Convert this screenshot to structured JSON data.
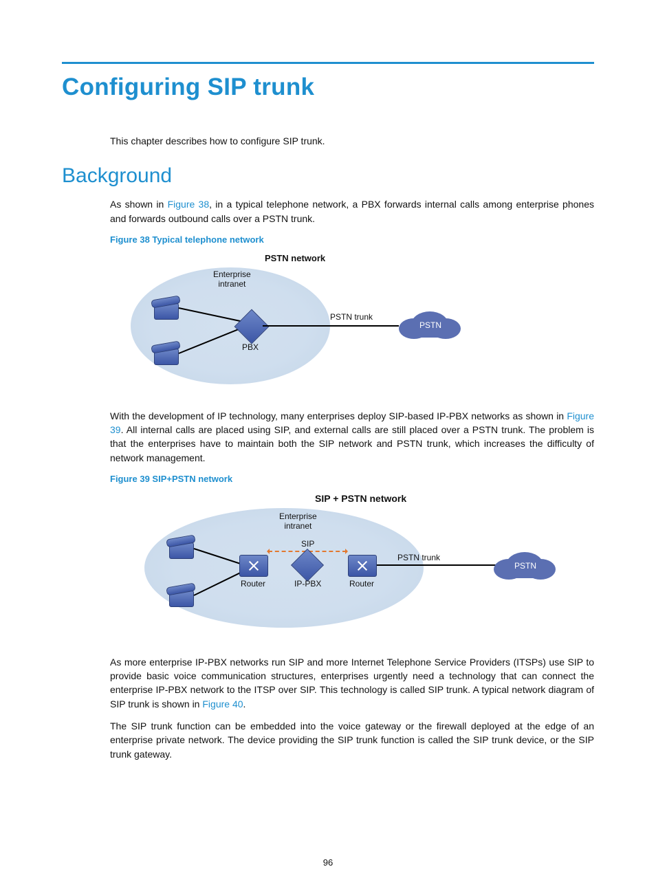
{
  "page_number": "96",
  "title": "Configuring SIP trunk",
  "intro": "This chapter describes how to configure SIP trunk.",
  "section_background": "Background",
  "para1_a": "As shown in ",
  "para1_link": "Figure 38",
  "para1_b": ", in a typical telephone network, a PBX forwards internal calls among enterprise phones and forwards outbound calls over a PSTN trunk.",
  "fig38_caption": "Figure 38 Typical telephone network",
  "fig38": {
    "net_title": "PSTN network",
    "intranet_l1": "Enterprise",
    "intranet_l2": "intranet",
    "pbx": "PBX",
    "trunk": "PSTN trunk",
    "cloud": "PSTN"
  },
  "para2_a": "With the development of IP technology, many enterprises deploy SIP-based IP-PBX networks as shown in ",
  "para2_link": "Figure 39",
  "para2_b": ". All internal calls are placed using SIP, and external calls are still placed over a PSTN trunk. The problem is that the enterprises have to maintain both the SIP network and PSTN trunk, which increases the difficulty of network management.",
  "fig39_caption": "Figure 39 SIP+PSTN network",
  "fig39": {
    "net_title": "SIP + PSTN network",
    "intranet_l1": "Enterprise",
    "intranet_l2": "intranet",
    "sip": "SIP",
    "router": "Router",
    "ippbx": "IP-PBX",
    "trunk": "PSTN trunk",
    "cloud": "PSTN"
  },
  "para3_a": "As more enterprise IP-PBX networks run SIP and more Internet Telephone Service Providers (ITSPs) use SIP to provide basic voice communication structures, enterprises urgently need a technology that can connect the enterprise IP-PBX network to the ITSP over SIP. This technology is called SIP trunk. A typical network diagram of SIP trunk is shown in ",
  "para3_link": "Figure 40",
  "para3_b": ".",
  "para4": "The SIP trunk function can be embedded into the voice gateway or the firewall deployed at the edge of an enterprise private network. The device providing the SIP trunk function is called the SIP trunk device, or the SIP trunk gateway."
}
